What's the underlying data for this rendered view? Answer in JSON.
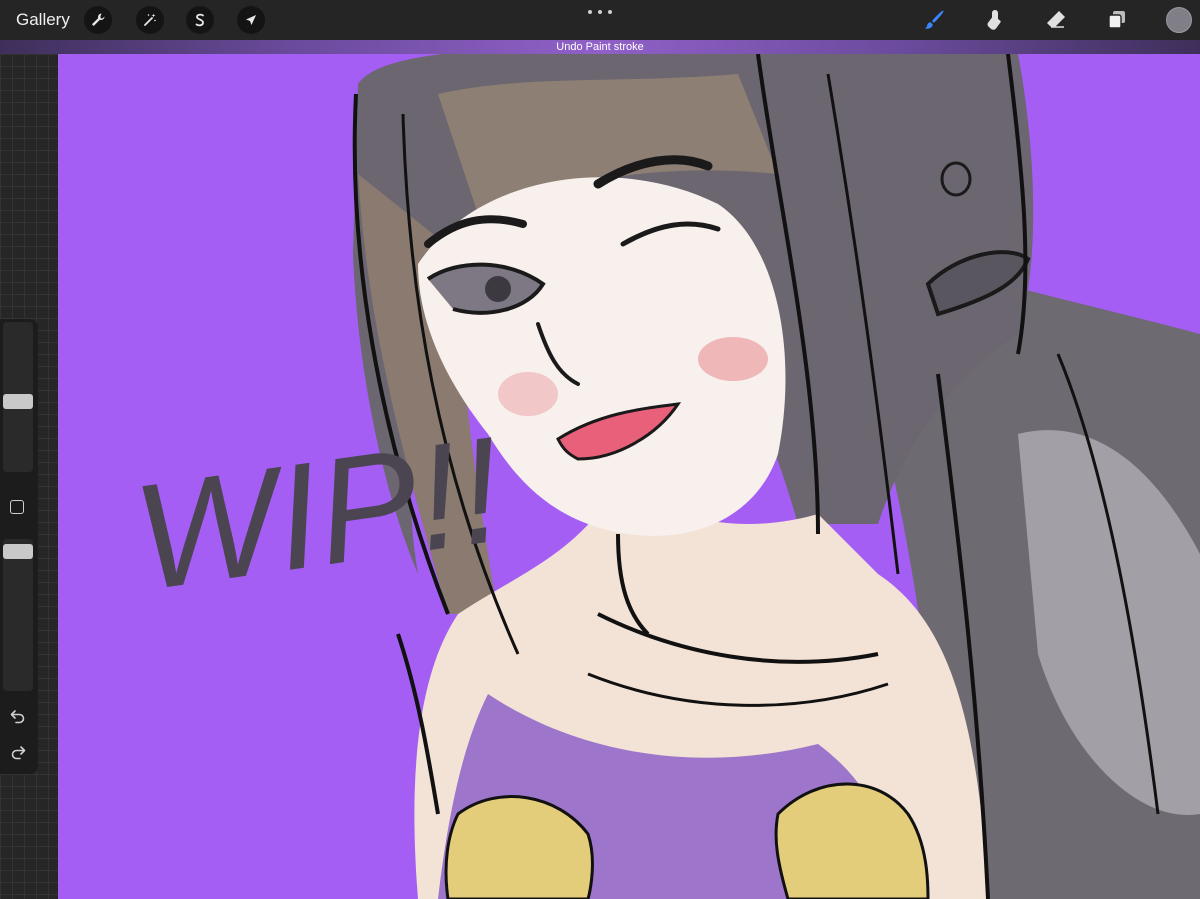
{
  "topbar": {
    "gallery_label": "Gallery",
    "left_tools": [
      "wrench-icon",
      "magic-wand-icon",
      "selection-s-icon",
      "transform-arrow-icon"
    ],
    "right_tools": [
      "brush-icon",
      "smudge-icon",
      "eraser-icon",
      "layers-icon"
    ],
    "current_color": "#807e86",
    "active_tool_color": "#3a86ff"
  },
  "notification": {
    "text": "Undo Paint stroke"
  },
  "sidebar": {
    "brush_size_slider": "size",
    "opacity_slider": "opacity",
    "undo_icon": "undo-icon",
    "redo_icon": "redo-icon"
  },
  "canvas": {
    "background_color": "#a45ef3",
    "artwork_text": "WIP!!"
  }
}
